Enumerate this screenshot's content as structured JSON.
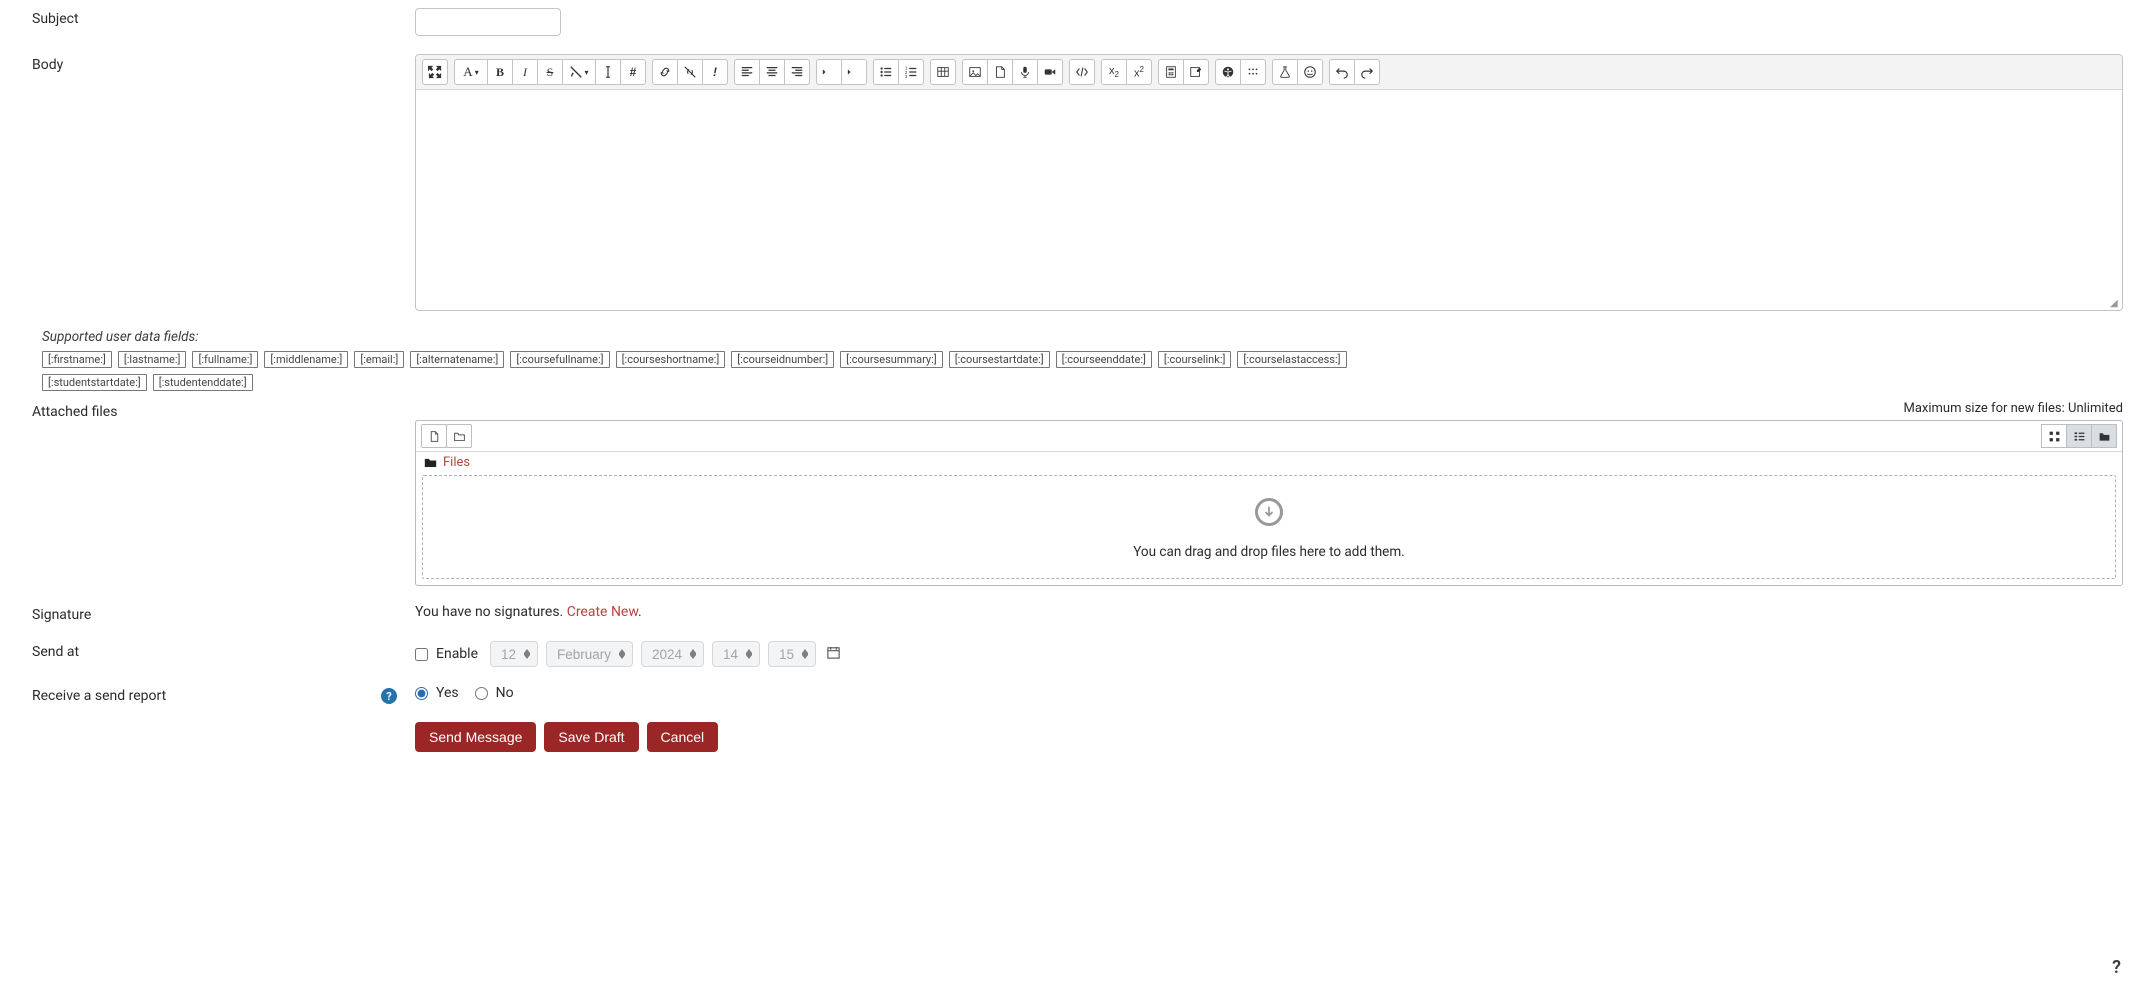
{
  "labels": {
    "subject": "Subject",
    "body": "Body",
    "supported_fields": "Supported user data fields:",
    "attached_files": "Attached files",
    "max_size": "Maximum size for new files: Unlimited",
    "files_link": "Files",
    "dropzone": "You can drag and drop files here to add them.",
    "signature": "Signature",
    "signature_text": "You have no signatures. ",
    "signature_create": "Create New",
    "signature_period": ".",
    "send_at": "Send at",
    "enable": "Enable",
    "receive_report": "Receive a send report",
    "yes": "Yes",
    "no": "No"
  },
  "tokens": [
    "[:firstname:]",
    "[:lastname:]",
    "[:fullname:]",
    "[:middlename:]",
    "[:email:]",
    "[:alternatename:]",
    "[:coursefullname:]",
    "[:courseshortname:]",
    "[:courseidnumber:]",
    "[:coursesummary:]",
    "[:coursestartdate:]",
    "[:courseenddate:]",
    "[:courselink:]",
    "[:courselastaccess:]",
    "[:studentstartdate:]",
    "[:studentenddate:]"
  ],
  "sendat": {
    "day": "12",
    "month": "February",
    "year": "2024",
    "hour": "14",
    "minute": "15"
  },
  "buttons": {
    "send": "Send Message",
    "save": "Save Draft",
    "cancel": "Cancel"
  },
  "help_indicator": "?"
}
